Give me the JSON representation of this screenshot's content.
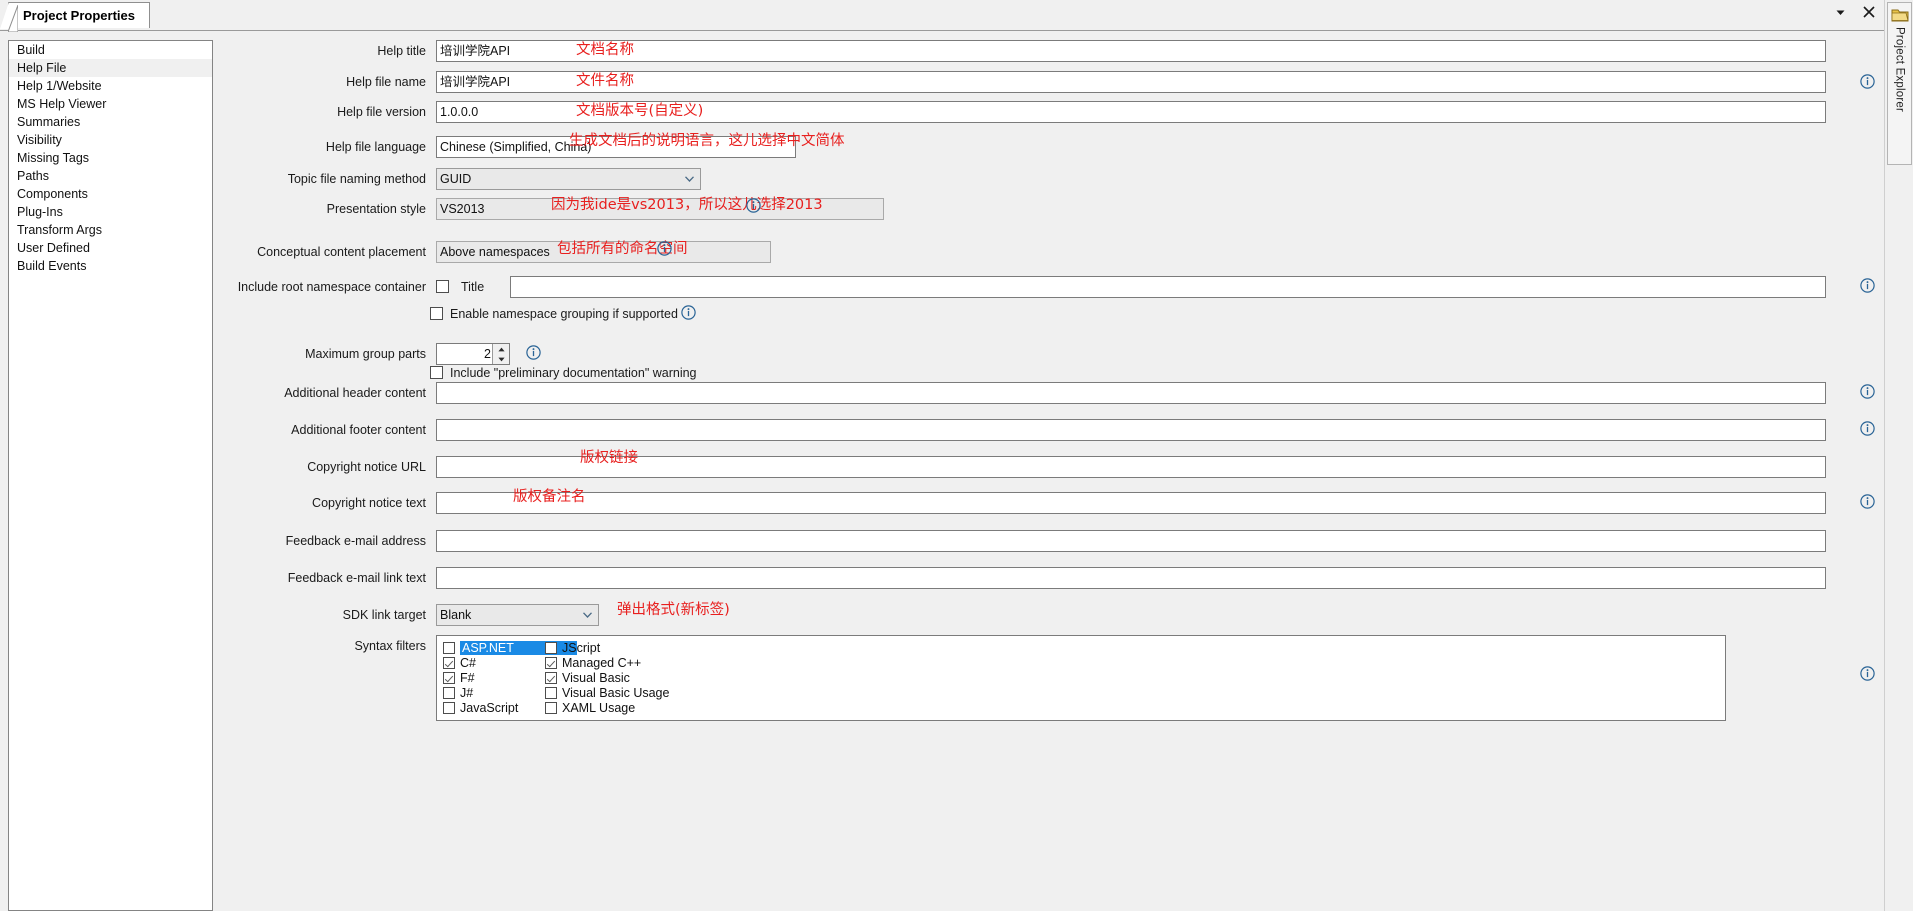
{
  "window": {
    "tab_title": "Project Properties",
    "dropdown_icon": "chevron-down-icon",
    "close_icon": "close-icon"
  },
  "rail": {
    "label": "Project Explorer",
    "icon": "folder-icon"
  },
  "sidebar": {
    "items": [
      {
        "label": "Build",
        "selected": false
      },
      {
        "label": "Help File",
        "selected": true
      },
      {
        "label": "Help 1/Website",
        "selected": false
      },
      {
        "label": "MS Help Viewer",
        "selected": false
      },
      {
        "label": "Summaries",
        "selected": false
      },
      {
        "label": "Visibility",
        "selected": false
      },
      {
        "label": "Missing Tags",
        "selected": false
      },
      {
        "label": "Paths",
        "selected": false
      },
      {
        "label": "Components",
        "selected": false
      },
      {
        "label": "Plug-Ins",
        "selected": false
      },
      {
        "label": "Transform Args",
        "selected": false
      },
      {
        "label": "User Defined",
        "selected": false
      },
      {
        "label": "Build Events",
        "selected": false
      }
    ]
  },
  "form": {
    "help_title": {
      "label": "Help title",
      "value": "培训学院API"
    },
    "help_file_name": {
      "label": "Help file name",
      "value": "培训学院API"
    },
    "help_file_version": {
      "label": "Help file version",
      "value": "1.0.0.0"
    },
    "help_file_language": {
      "label": "Help file language",
      "value": "Chinese (Simplified, China)"
    },
    "topic_file_naming_method": {
      "label": "Topic file naming method",
      "value": "GUID"
    },
    "presentation_style": {
      "label": "Presentation style",
      "value": "VS2013"
    },
    "conceptual_content_placement": {
      "label": "Conceptual content placement",
      "value": "Above namespaces"
    },
    "include_root_namespace_container": {
      "label": "Include root namespace container",
      "checked": false
    },
    "title": {
      "label": "Title",
      "value": ""
    },
    "enable_namespace_grouping": {
      "label": "Enable namespace grouping if supported",
      "checked": false
    },
    "maximum_group_parts": {
      "label": "Maximum group parts",
      "value": "2"
    },
    "include_preliminary_warning": {
      "label": "Include \"preliminary documentation\" warning",
      "checked": false
    },
    "additional_header_content": {
      "label": "Additional header content",
      "value": ""
    },
    "additional_footer_content": {
      "label": "Additional footer content",
      "value": ""
    },
    "copyright_notice_url": {
      "label": "Copyright notice URL",
      "value": ""
    },
    "copyright_notice_text": {
      "label": "Copyright notice text",
      "value": ""
    },
    "feedback_email_address": {
      "label": "Feedback e-mail address",
      "value": ""
    },
    "feedback_email_link_text": {
      "label": "Feedback e-mail link text",
      "value": ""
    },
    "sdk_link_target": {
      "label": "SDK link target",
      "value": "Blank"
    },
    "syntax_filters": {
      "label": "Syntax filters",
      "left_column": [
        {
          "label": "ASP.NET",
          "checked": false,
          "selected": true
        },
        {
          "label": "C#",
          "checked": true,
          "selected": false
        },
        {
          "label": "F#",
          "checked": true,
          "selected": false
        },
        {
          "label": "J#",
          "checked": false,
          "selected": false
        },
        {
          "label": "JavaScript",
          "checked": false,
          "selected": false
        }
      ],
      "right_column": [
        {
          "label": "JScript",
          "checked": false,
          "selected": false
        },
        {
          "label": "Managed C++",
          "checked": true,
          "selected": false
        },
        {
          "label": "Visual Basic",
          "checked": true,
          "selected": false
        },
        {
          "label": "Visual Basic Usage",
          "checked": false,
          "selected": false
        },
        {
          "label": "XAML Usage",
          "checked": false,
          "selected": false
        }
      ]
    }
  },
  "annotations": {
    "a1": "文档名称",
    "a2": "文件名称",
    "a3": "文档版本号(自定义)",
    "a4": "生成文档后的说明语言，这儿选择中文简体",
    "a5": "因为我ide是vs2013，所以这儿选择2013",
    "a6": "包括所有的命名空间",
    "a7": "版权链接",
    "a8": "版权备注名",
    "a9": "弹出格式(新标签)"
  },
  "colors": {
    "accent_selection": "#1a8ae5",
    "annotation": "#e8201f",
    "window_bg": "#f0f0f0",
    "field_border": "#7b7b7b"
  }
}
